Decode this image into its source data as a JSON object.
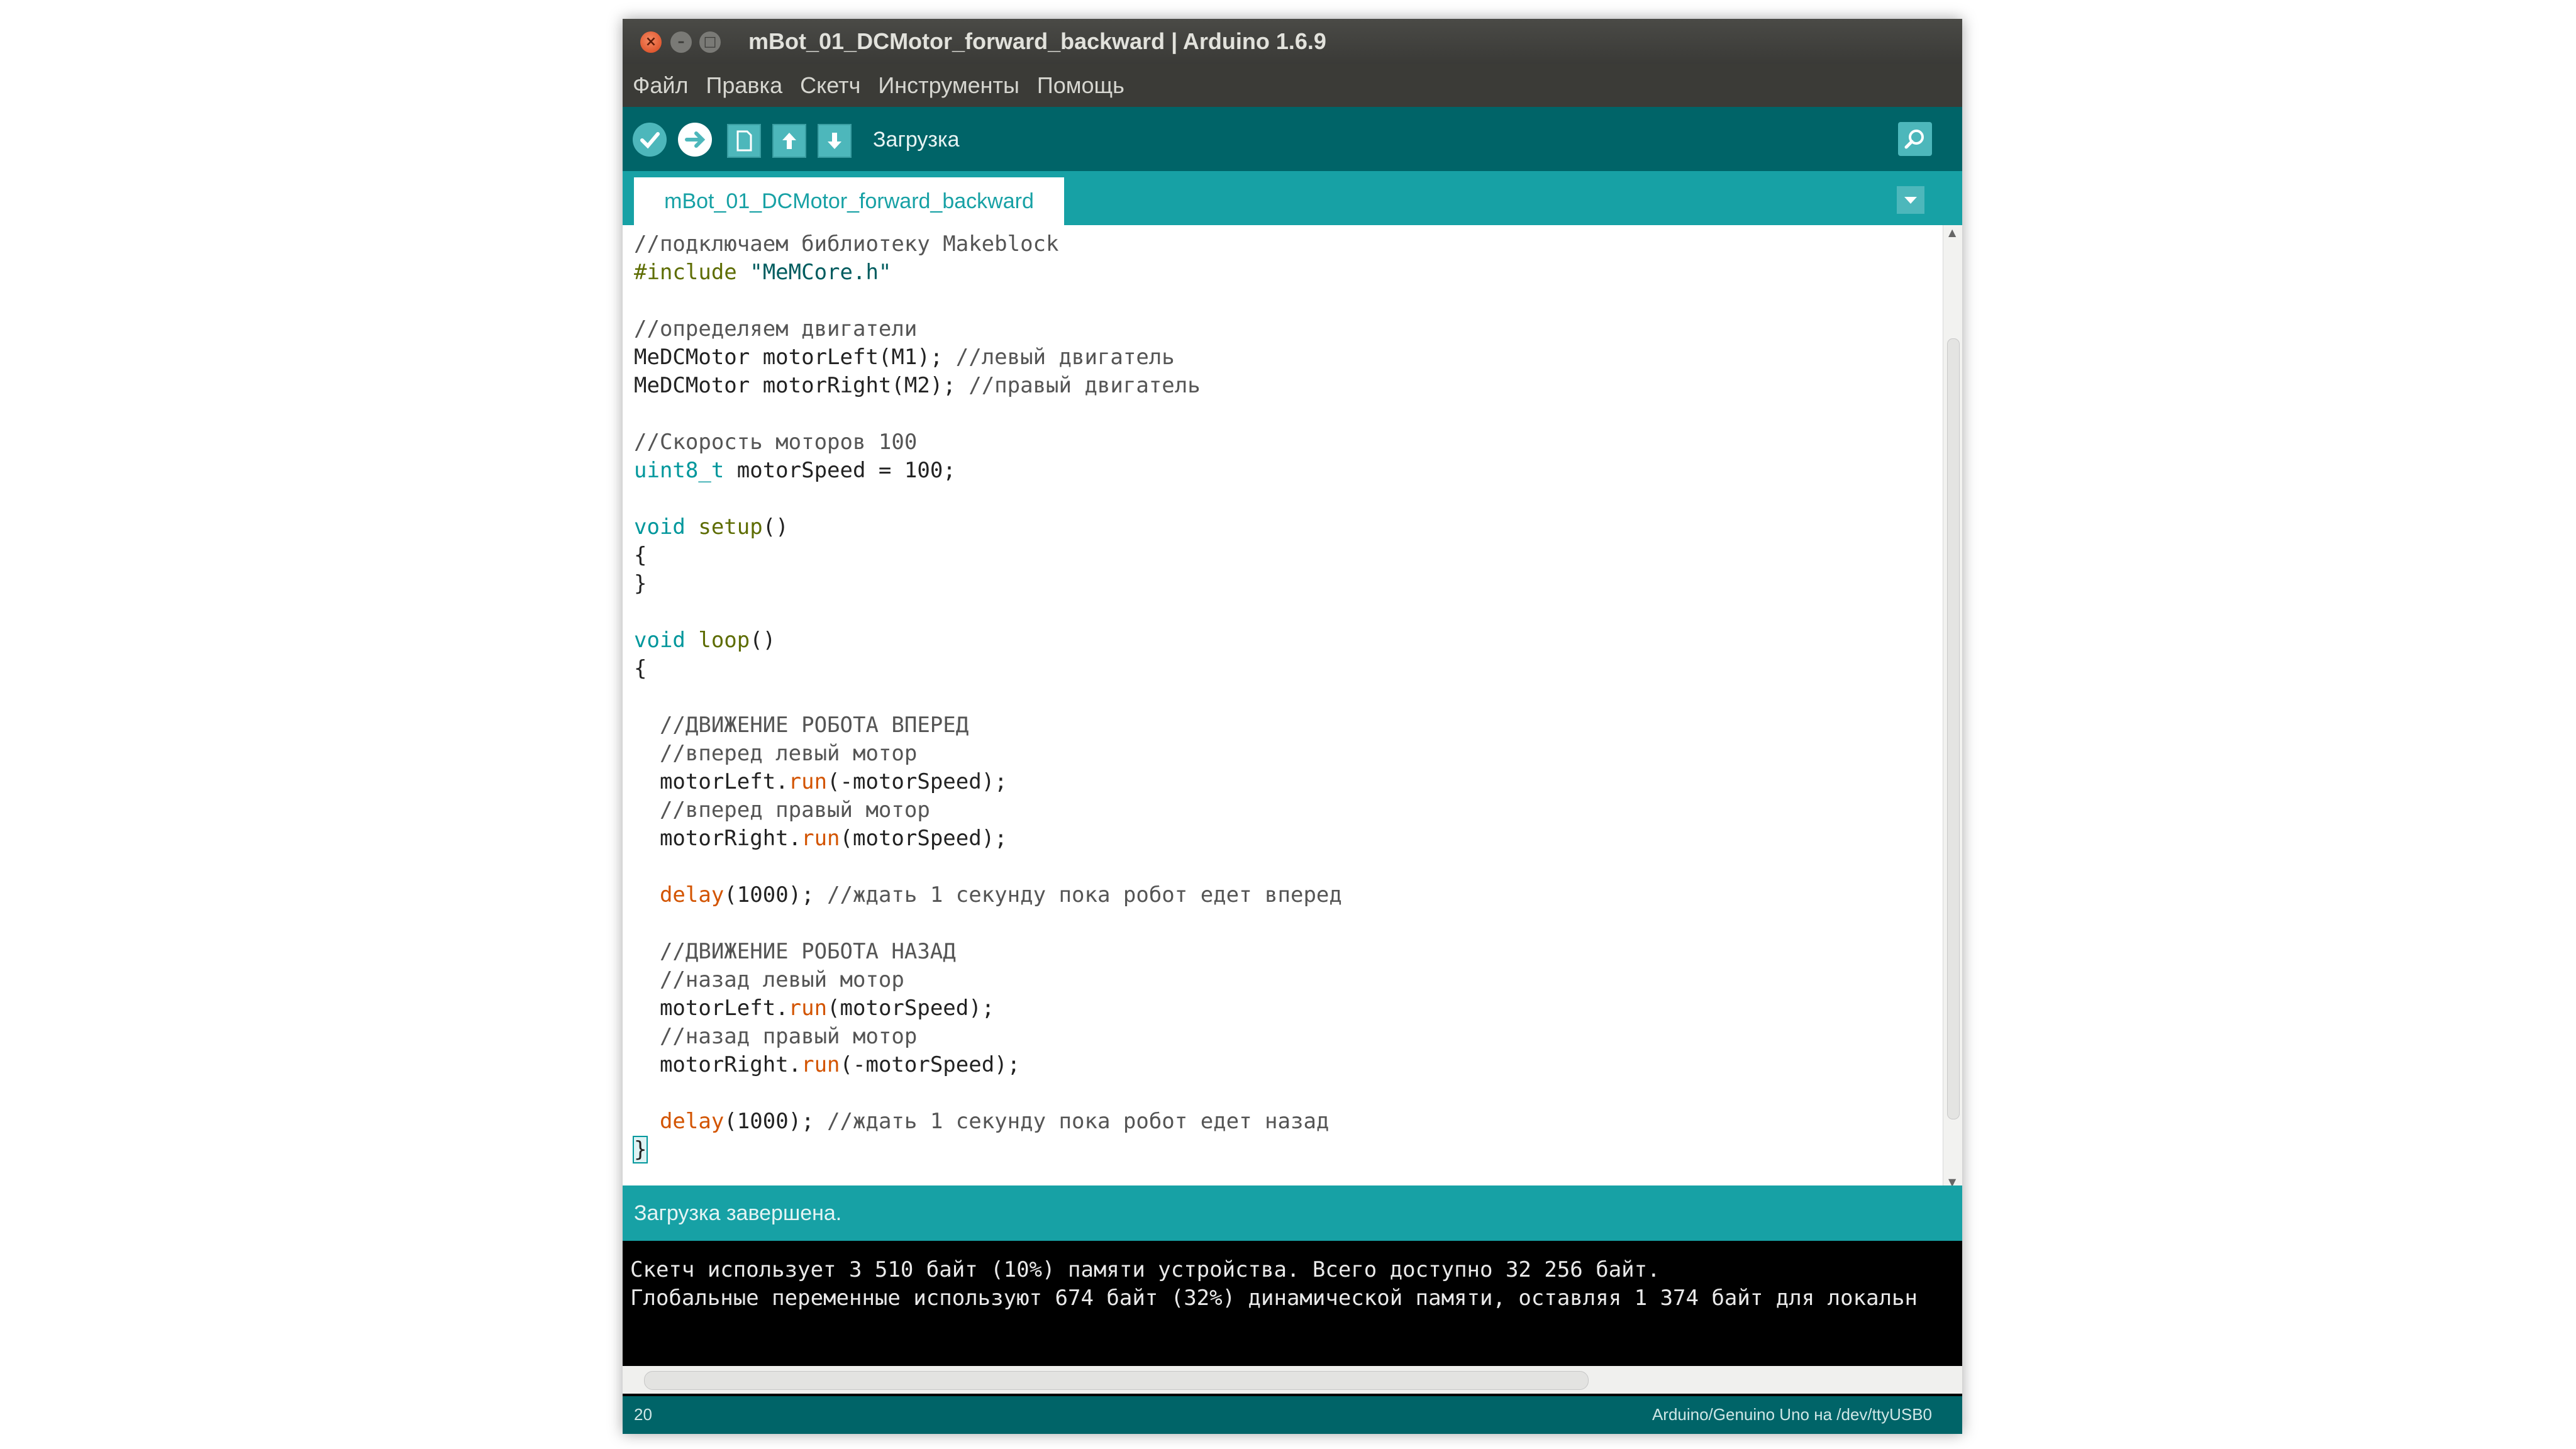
{
  "window": {
    "title": "mBot_01_DCMotor_forward_backward | Arduino 1.6.9"
  },
  "menu": {
    "items": [
      {
        "label": "Файл"
      },
      {
        "label": "Правка"
      },
      {
        "label": "Скетч"
      },
      {
        "label": "Инструменты"
      },
      {
        "label": "Помощь"
      }
    ]
  },
  "toolbar": {
    "hover_label": "Загрузка",
    "buttons": [
      "verify-icon",
      "upload-icon",
      "new-icon",
      "open-icon",
      "save-icon"
    ],
    "serial_monitor_icon": "magnifier-icon"
  },
  "tab": {
    "name": "mBot_01_DCMotor_forward_backward"
  },
  "code": [
    [
      {
        "t": "//подключаем библиотеку Makeblock",
        "c": "c-comment"
      }
    ],
    [
      {
        "t": "#include",
        "c": "c-pre"
      },
      {
        "t": " \"MeMCore.h\"",
        "c": "c-str"
      }
    ],
    [],
    [
      {
        "t": "//определяем двигатели",
        "c": "c-comment"
      }
    ],
    [
      {
        "t": "MeDCMotor motorLeft(M1); ",
        "c": "c-plain"
      },
      {
        "t": "//левый двигатель",
        "c": "c-comment"
      }
    ],
    [
      {
        "t": "MeDCMotor motorRight(M2); ",
        "c": "c-plain"
      },
      {
        "t": "//правый двигатель",
        "c": "c-comment"
      }
    ],
    [],
    [
      {
        "t": "//Скорость моторов 100",
        "c": "c-comment"
      }
    ],
    [
      {
        "t": "uint8_t",
        "c": "c-kw"
      },
      {
        "t": " motorSpeed = 100;",
        "c": "c-plain"
      }
    ],
    [],
    [
      {
        "t": "void",
        "c": "c-kw"
      },
      {
        "t": " setup",
        "c": "c-fn"
      },
      {
        "t": "()",
        "c": "c-plain"
      }
    ],
    [
      {
        "t": "{",
        "c": "c-plain"
      }
    ],
    [
      {
        "t": "}",
        "c": "c-plain"
      }
    ],
    [],
    [
      {
        "t": "void",
        "c": "c-kw"
      },
      {
        "t": " loop",
        "c": "c-fn"
      },
      {
        "t": "()",
        "c": "c-plain"
      }
    ],
    [
      {
        "t": "{",
        "c": "c-plain"
      }
    ],
    [],
    [
      {
        "t": "  //ДВИЖЕНИЕ РОБОТА ВПЕРЕД",
        "c": "c-comment"
      }
    ],
    [
      {
        "t": "  //вперед левый мотор",
        "c": "c-comment"
      }
    ],
    [
      {
        "t": "  motorLeft.",
        "c": "c-plain"
      },
      {
        "t": "run",
        "c": "c-lib"
      },
      {
        "t": "(-motorSpeed);",
        "c": "c-plain"
      }
    ],
    [
      {
        "t": "  //вперед правый мотор",
        "c": "c-comment"
      }
    ],
    [
      {
        "t": "  motorRight.",
        "c": "c-plain"
      },
      {
        "t": "run",
        "c": "c-lib"
      },
      {
        "t": "(motorSpeed);",
        "c": "c-plain"
      }
    ],
    [],
    [
      {
        "t": "  ",
        "c": "c-plain"
      },
      {
        "t": "delay",
        "c": "c-lib"
      },
      {
        "t": "(1000); ",
        "c": "c-plain"
      },
      {
        "t": "//ждать 1 секунду пока робот едет вперед",
        "c": "c-comment"
      }
    ],
    [],
    [
      {
        "t": "  //ДВИЖЕНИЕ РОБОТА НАЗАД",
        "c": "c-comment"
      }
    ],
    [
      {
        "t": "  //назад левый мотор",
        "c": "c-comment"
      }
    ],
    [
      {
        "t": "  motorLeft.",
        "c": "c-plain"
      },
      {
        "t": "run",
        "c": "c-lib"
      },
      {
        "t": "(motorSpeed);",
        "c": "c-plain"
      }
    ],
    [
      {
        "t": "  //назад правый мотор",
        "c": "c-comment"
      }
    ],
    [
      {
        "t": "  motorRight.",
        "c": "c-plain"
      },
      {
        "t": "run",
        "c": "c-lib"
      },
      {
        "t": "(-motorSpeed);",
        "c": "c-plain"
      }
    ],
    [],
    [
      {
        "t": "  ",
        "c": "c-plain"
      },
      {
        "t": "delay",
        "c": "c-lib"
      },
      {
        "t": "(1000); ",
        "c": "c-plain"
      },
      {
        "t": "//ждать 1 секунду пока робот едет назад",
        "c": "c-comment"
      }
    ],
    [
      {
        "t": "}",
        "c": "c-cursor"
      }
    ]
  ],
  "status": {
    "message": "Загрузка завершена."
  },
  "console": {
    "lines": [
      "Скетч использует 3 510 байт (10%) памяти устройства. Всего доступно 32 256 байт.",
      "Глобальные переменные используют 674 байт (32%) динамической памяти, оставляя 1 374 байт для локальн"
    ]
  },
  "footer": {
    "line_number": "20",
    "board": "Arduino/Genuino Uno на /dev/ttyUSB0"
  },
  "colors": {
    "toolbar": "#006468",
    "tabbar": "#17a1a5",
    "button": "#4db7bb"
  }
}
